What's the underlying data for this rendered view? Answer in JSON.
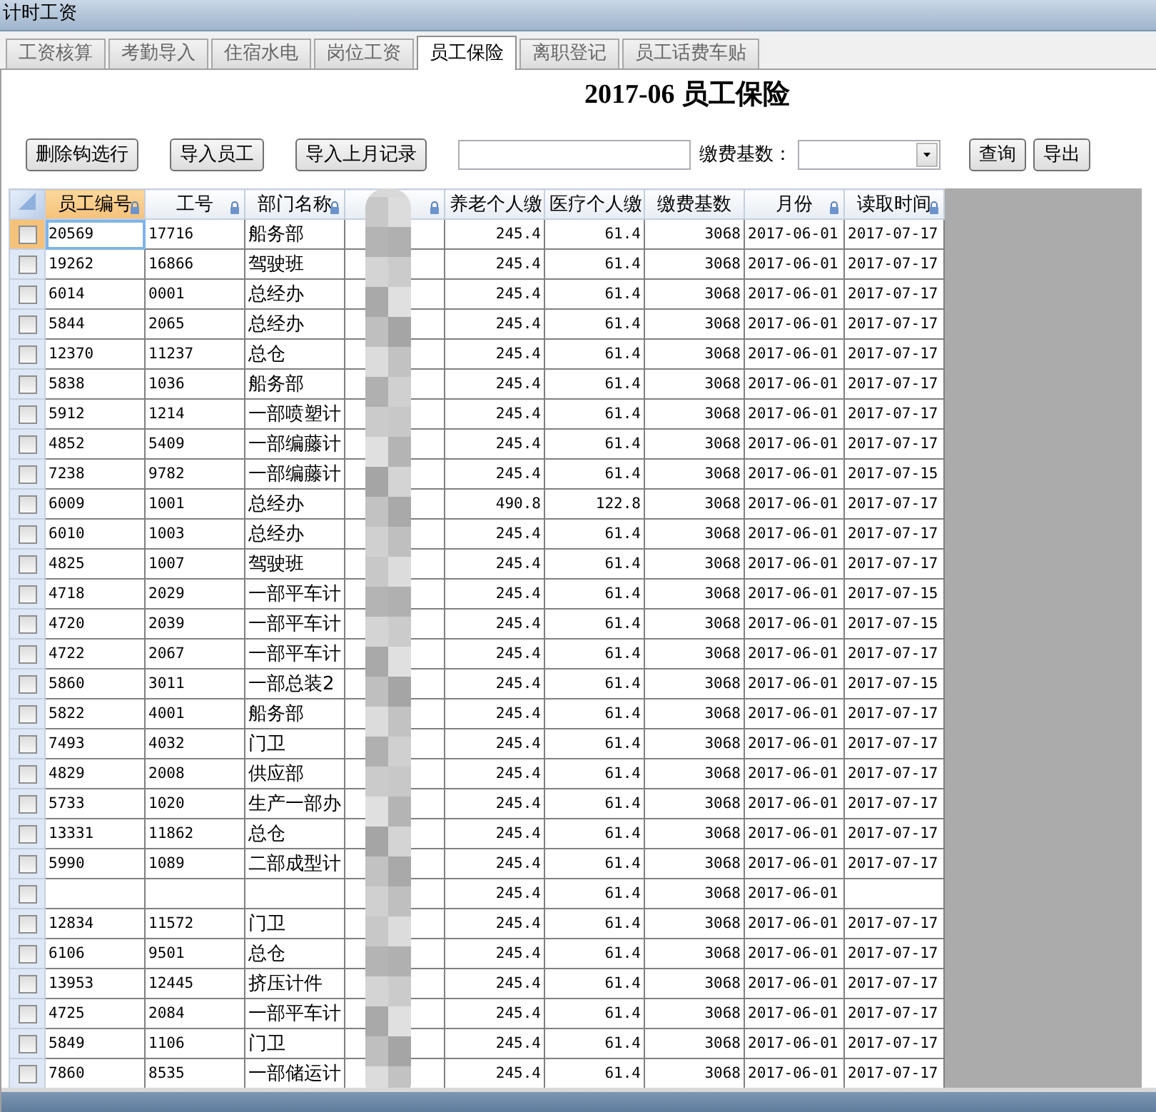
{
  "window": {
    "title": "计时工资"
  },
  "tabs": [
    {
      "label": "工资核算",
      "selected": false
    },
    {
      "label": "考勤导入",
      "selected": false
    },
    {
      "label": "住宿水电",
      "selected": false
    },
    {
      "label": "岗位工资",
      "selected": false
    },
    {
      "label": "员工保险",
      "selected": true
    },
    {
      "label": "离职登记",
      "selected": false
    },
    {
      "label": "员工话费车贴",
      "selected": false
    }
  ],
  "heading": "2017-06 员工保险",
  "toolbar": [
    {
      "kind": "button",
      "label": "删除钩选行"
    },
    {
      "kind": "button",
      "label": "导入员工"
    },
    {
      "kind": "button",
      "label": "导入上月记录"
    },
    {
      "kind": "field"
    },
    {
      "kind": "label",
      "label": "缴费基数："
    },
    {
      "kind": "dropdown"
    },
    {
      "kind": "button",
      "label": "查询"
    },
    {
      "kind": "button",
      "label": "导出"
    }
  ],
  "table": {
    "columns": [
      {
        "label": "员工编号",
        "locked": true,
        "selected": true
      },
      {
        "label": "工号",
        "locked": true,
        "selected": false
      },
      {
        "label": "部门名称",
        "locked": true,
        "selected": false
      },
      {
        "locked": true,
        "selected": false
      },
      {
        "label": "养老个人缴",
        "locked": false,
        "selected": false
      },
      {
        "label": "医疗个人缴",
        "locked": false,
        "selected": false
      },
      {
        "label": "缴费基数",
        "locked": false,
        "selected": false
      },
      {
        "label": "月份",
        "locked": true,
        "selected": false
      },
      {
        "label": "读取时间",
        "locked": true,
        "selected": false
      }
    ],
    "rows": [
      {
        "checked": false,
        "current": true,
        "employee_no": "20569",
        "job_no": "17716",
        "department": "船务部",
        "pension": "245.4",
        "medical": "61.4",
        "base": "3068",
        "month": "2017-06-01",
        "read_time": "2017-07-17"
      },
      {
        "checked": false,
        "current": false,
        "employee_no": "19262",
        "job_no": "16866",
        "department": "驾驶班",
        "pension": "245.4",
        "medical": "61.4",
        "base": "3068",
        "month": "2017-06-01",
        "read_time": "2017-07-17"
      },
      {
        "checked": false,
        "current": false,
        "employee_no": "6014",
        "job_no": "0001",
        "department": "总经办",
        "pension": "245.4",
        "medical": "61.4",
        "base": "3068",
        "month": "2017-06-01",
        "read_time": "2017-07-17"
      },
      {
        "checked": false,
        "current": false,
        "employee_no": "5844",
        "job_no": "2065",
        "department": "总经办",
        "pension": "245.4",
        "medical": "61.4",
        "base": "3068",
        "month": "2017-06-01",
        "read_time": "2017-07-17"
      },
      {
        "checked": false,
        "current": false,
        "employee_no": "12370",
        "job_no": "11237",
        "department": "总仓",
        "pension": "245.4",
        "medical": "61.4",
        "base": "3068",
        "month": "2017-06-01",
        "read_time": "2017-07-17"
      },
      {
        "checked": false,
        "current": false,
        "employee_no": "5838",
        "job_no": "1036",
        "department": "船务部",
        "pension": "245.4",
        "medical": "61.4",
        "base": "3068",
        "month": "2017-06-01",
        "read_time": "2017-07-17"
      },
      {
        "checked": false,
        "current": false,
        "employee_no": "5912",
        "job_no": "1214",
        "department": "一部喷塑计",
        "pension": "245.4",
        "medical": "61.4",
        "base": "3068",
        "month": "2017-06-01",
        "read_time": "2017-07-17"
      },
      {
        "checked": false,
        "current": false,
        "employee_no": "4852",
        "job_no": "5409",
        "department": "一部编藤计",
        "pension": "245.4",
        "medical": "61.4",
        "base": "3068",
        "month": "2017-06-01",
        "read_time": "2017-07-17"
      },
      {
        "checked": false,
        "current": false,
        "employee_no": "7238",
        "job_no": "9782",
        "department": "一部编藤计",
        "pension": "245.4",
        "medical": "61.4",
        "base": "3068",
        "month": "2017-06-01",
        "read_time": "2017-07-15"
      },
      {
        "checked": false,
        "current": false,
        "employee_no": "6009",
        "job_no": "1001",
        "department": "总经办",
        "pension": "490.8",
        "medical": "122.8",
        "base": "3068",
        "month": "2017-06-01",
        "read_time": "2017-07-17"
      },
      {
        "checked": false,
        "current": false,
        "employee_no": "6010",
        "job_no": "1003",
        "department": "总经办",
        "pension": "245.4",
        "medical": "61.4",
        "base": "3068",
        "month": "2017-06-01",
        "read_time": "2017-07-17"
      },
      {
        "checked": false,
        "current": false,
        "employee_no": "4825",
        "job_no": "1007",
        "department": "驾驶班",
        "pension": "245.4",
        "medical": "61.4",
        "base": "3068",
        "month": "2017-06-01",
        "read_time": "2017-07-17"
      },
      {
        "checked": false,
        "current": false,
        "employee_no": "4718",
        "job_no": "2029",
        "department": "一部平车计",
        "pension": "245.4",
        "medical": "61.4",
        "base": "3068",
        "month": "2017-06-01",
        "read_time": "2017-07-15"
      },
      {
        "checked": false,
        "current": false,
        "employee_no": "4720",
        "job_no": "2039",
        "department": "一部平车计",
        "pension": "245.4",
        "medical": "61.4",
        "base": "3068",
        "month": "2017-06-01",
        "read_time": "2017-07-15"
      },
      {
        "checked": false,
        "current": false,
        "employee_no": "4722",
        "job_no": "2067",
        "department": "一部平车计",
        "pension": "245.4",
        "medical": "61.4",
        "base": "3068",
        "month": "2017-06-01",
        "read_time": "2017-07-17"
      },
      {
        "checked": false,
        "current": false,
        "employee_no": "5860",
        "job_no": "3011",
        "department": "一部总装2",
        "pension": "245.4",
        "medical": "61.4",
        "base": "3068",
        "month": "2017-06-01",
        "read_time": "2017-07-15"
      },
      {
        "checked": false,
        "current": false,
        "employee_no": "5822",
        "job_no": "4001",
        "department": "船务部",
        "pension": "245.4",
        "medical": "61.4",
        "base": "3068",
        "month": "2017-06-01",
        "read_time": "2017-07-17"
      },
      {
        "checked": false,
        "current": false,
        "employee_no": "7493",
        "job_no": "4032",
        "department": "门卫",
        "pension": "245.4",
        "medical": "61.4",
        "base": "3068",
        "month": "2017-06-01",
        "read_time": "2017-07-17"
      },
      {
        "checked": false,
        "current": false,
        "employee_no": "4829",
        "job_no": "2008",
        "department": "供应部",
        "pension": "245.4",
        "medical": "61.4",
        "base": "3068",
        "month": "2017-06-01",
        "read_time": "2017-07-17"
      },
      {
        "checked": false,
        "current": false,
        "employee_no": "5733",
        "job_no": "1020",
        "department": "生产一部办",
        "pension": "245.4",
        "medical": "61.4",
        "base": "3068",
        "month": "2017-06-01",
        "read_time": "2017-07-17"
      },
      {
        "checked": false,
        "current": false,
        "employee_no": "13331",
        "job_no": "11862",
        "department": "总仓",
        "pension": "245.4",
        "medical": "61.4",
        "base": "3068",
        "month": "2017-06-01",
        "read_time": "2017-07-17"
      },
      {
        "checked": false,
        "current": false,
        "employee_no": "5990",
        "job_no": "1089",
        "department": "二部成型计",
        "pension": "245.4",
        "medical": "61.4",
        "base": "3068",
        "month": "2017-06-01",
        "read_time": "2017-07-17"
      },
      {
        "checked": false,
        "current": false,
        "pension": "245.4",
        "medical": "61.4",
        "base": "3068",
        "month": "2017-06-01"
      },
      {
        "checked": false,
        "current": false,
        "employee_no": "12834",
        "job_no": "11572",
        "department": "门卫",
        "pension": "245.4",
        "medical": "61.4",
        "base": "3068",
        "month": "2017-06-01",
        "read_time": "2017-07-17"
      },
      {
        "checked": false,
        "current": false,
        "employee_no": "6106",
        "job_no": "9501",
        "department": "总仓",
        "pension": "245.4",
        "medical": "61.4",
        "base": "3068",
        "month": "2017-06-01",
        "read_time": "2017-07-17"
      },
      {
        "checked": false,
        "current": false,
        "employee_no": "13953",
        "job_no": "12445",
        "department": "挤压计件",
        "pension": "245.4",
        "medical": "61.4",
        "base": "3068",
        "month": "2017-06-01",
        "read_time": "2017-07-17"
      },
      {
        "checked": false,
        "current": false,
        "employee_no": "4725",
        "job_no": "2084",
        "department": "一部平车计",
        "pension": "245.4",
        "medical": "61.4",
        "base": "3068",
        "month": "2017-06-01",
        "read_time": "2017-07-17"
      },
      {
        "checked": false,
        "current": false,
        "employee_no": "5849",
        "job_no": "1106",
        "department": "门卫",
        "pension": "245.4",
        "medical": "61.4",
        "base": "3068",
        "month": "2017-06-01",
        "read_time": "2017-07-17"
      },
      {
        "checked": false,
        "current": false,
        "employee_no": "7860",
        "job_no": "8535",
        "department": "一部储运计",
        "pension": "245.4",
        "medical": "61.4",
        "base": "3068",
        "month": "2017-06-01",
        "read_time": "2017-07-17"
      }
    ]
  }
}
